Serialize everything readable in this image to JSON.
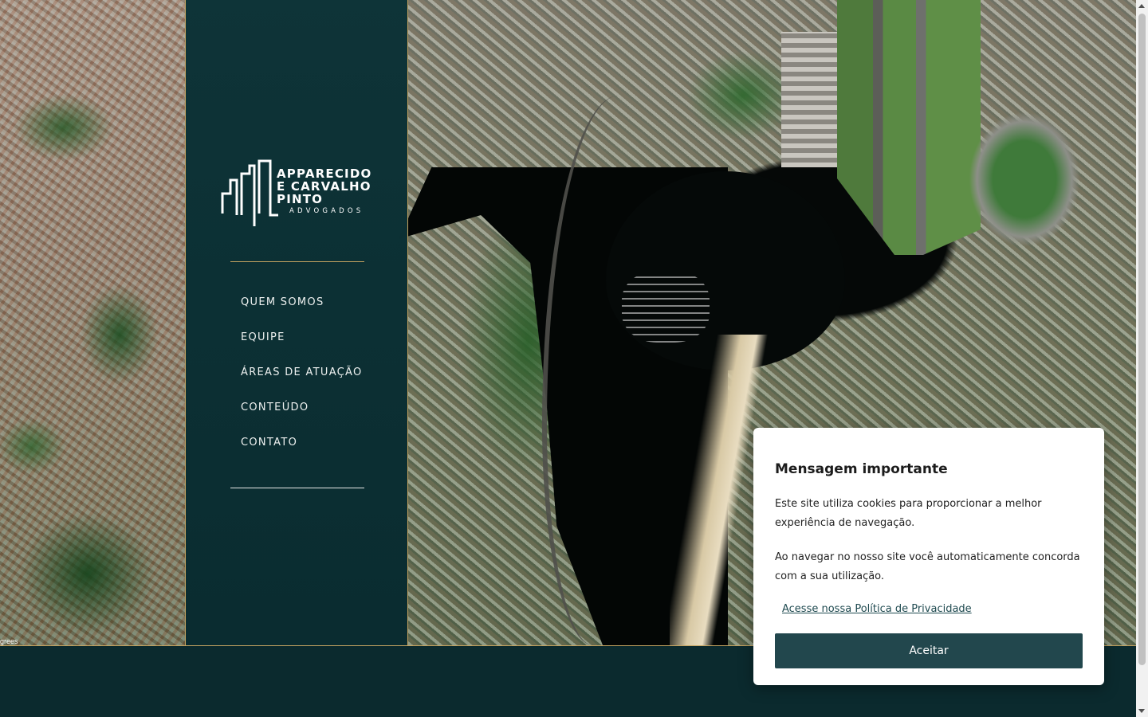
{
  "background": {
    "map_credit": "grees"
  },
  "brand": {
    "name_line1": "APPARECIDO",
    "name_line2": "E CARVALHO",
    "name_line3": "PINTO",
    "tagline": "ADVOGADOS",
    "accent_color": "#c5a461",
    "primary_color": "#0e3438"
  },
  "nav": {
    "items": [
      {
        "label": "QUEM SOMOS"
      },
      {
        "label": "EQUIPE"
      },
      {
        "label": "ÁREAS DE ATUAÇÃO"
      },
      {
        "label": "CONTEÚDO"
      },
      {
        "label": "CONTATO"
      }
    ]
  },
  "cookie_notice": {
    "title": "Mensagem importante",
    "paragraph1": "Este site utiliza cookies para proporcionar a melhor experiência de navegação.",
    "paragraph2": "Ao navegar no nosso site você automaticamente concorda com a sua utilização.",
    "privacy_link": "Acesse nossa Política de Privacidade",
    "accept_button": "Aceitar",
    "button_color": "#22474d"
  }
}
